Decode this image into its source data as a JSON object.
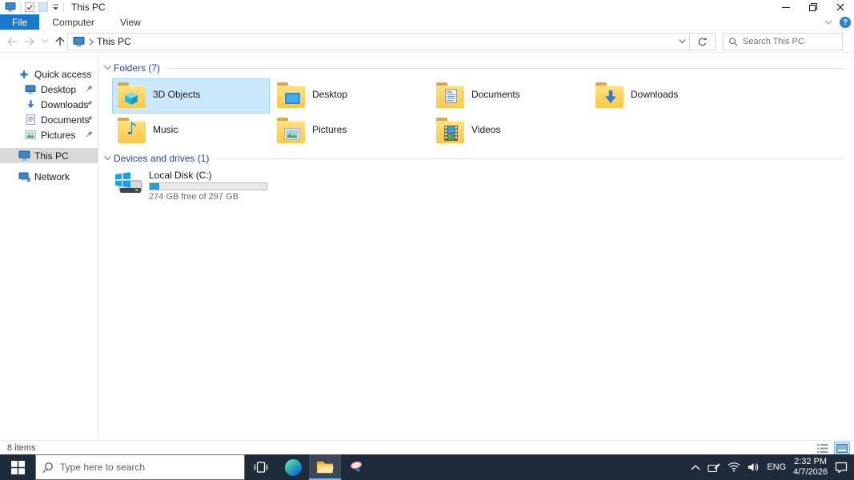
{
  "window": {
    "title": "This PC"
  },
  "ribbon": {
    "tabs": [
      "File",
      "Computer",
      "View"
    ]
  },
  "navigation": {
    "breadcrumb_root": "This PC",
    "search_placeholder": "Search This PC"
  },
  "sidebar": {
    "items": [
      {
        "label": "Quick access",
        "icon": "star-icon"
      },
      {
        "label": "Desktop",
        "icon": "monitor-icon",
        "pinned": true
      },
      {
        "label": "Downloads",
        "icon": "download-arrow-icon",
        "pinned": true
      },
      {
        "label": "Documents",
        "icon": "document-icon",
        "pinned": true
      },
      {
        "label": "Pictures",
        "icon": "picture-icon",
        "pinned": true
      },
      {
        "label": "This PC",
        "icon": "computer-icon",
        "selected": true
      },
      {
        "label": "Network",
        "icon": "network-icon"
      }
    ]
  },
  "content": {
    "groups": [
      {
        "label": "Folders (7)"
      },
      {
        "label": "Devices and drives (1)"
      }
    ],
    "folders": [
      {
        "label": "3D Objects",
        "icon": "folder-3d-cube-icon",
        "selected": true
      },
      {
        "label": "Desktop",
        "icon": "folder-screen-icon"
      },
      {
        "label": "Documents",
        "icon": "folder-document-icon"
      },
      {
        "label": "Downloads",
        "icon": "folder-download-icon"
      },
      {
        "label": "Music",
        "icon": "folder-music-note-icon"
      },
      {
        "label": "Pictures",
        "icon": "folder-picture-icon"
      },
      {
        "label": "Videos",
        "icon": "folder-filmstrip-icon"
      }
    ],
    "drives": [
      {
        "label": "Local Disk (C:)",
        "capacity_text": "274 GB free of 297 GB",
        "used_percent": 8
      }
    ]
  },
  "statusbar": {
    "items_text": "8 items"
  },
  "taskbar": {
    "search_placeholder": "Type here to search",
    "tray": {
      "language": "ENG",
      "time": "2:32 PM",
      "date": "4/7/2026"
    }
  },
  "colors": {
    "file_tab_blue": "#1979ca",
    "selection_bg": "#cce8ff",
    "selection_border": "#99d1ff",
    "group_header_text": "#26478e",
    "drive_bar_fill": "#26a0da",
    "taskbar_bg": "#1d2b3a",
    "folder_yellow": "#fdd35e",
    "help_blue": "#2d7dd2"
  }
}
